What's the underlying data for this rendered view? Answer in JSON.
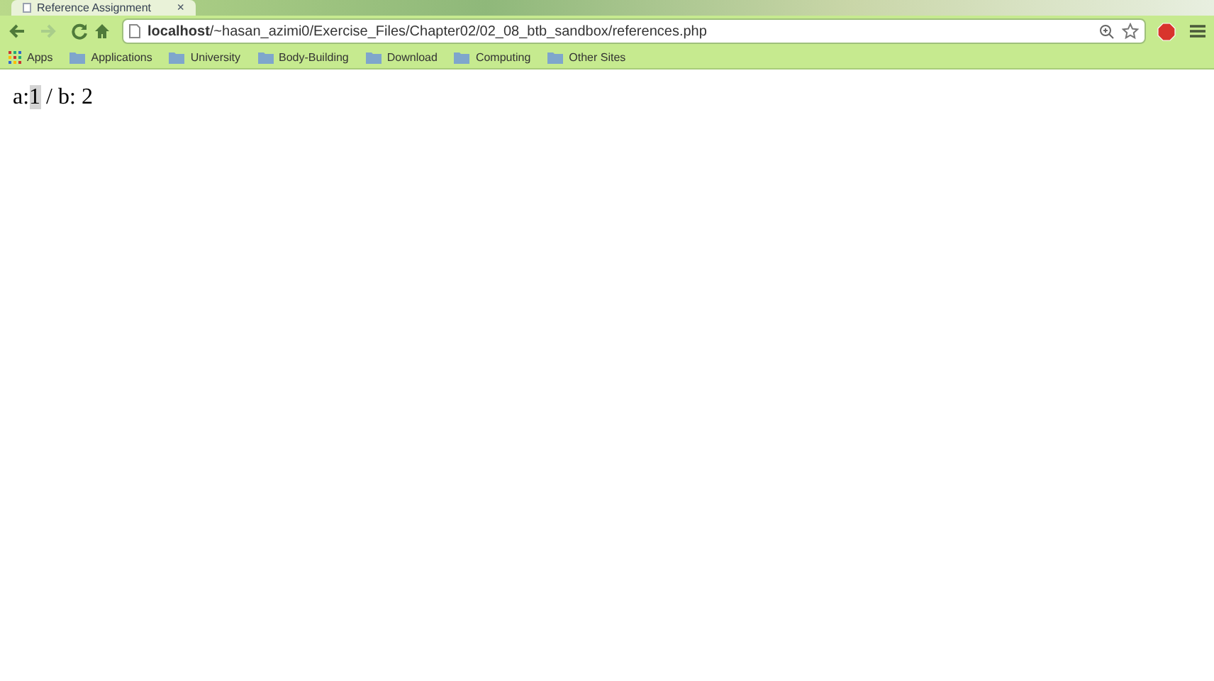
{
  "tab": {
    "title": "Reference Assignment",
    "close": "×"
  },
  "address_bar": {
    "host": "localhost",
    "path": "/~hasan_azimi0/Exercise_Files/Chapter02/02_08_btb_sandbox/references.php"
  },
  "bookmarks": [
    {
      "label": "Apps",
      "kind": "apps"
    },
    {
      "label": "Applications",
      "kind": "folder"
    },
    {
      "label": "University",
      "kind": "folder"
    },
    {
      "label": "Body-Building",
      "kind": "folder"
    },
    {
      "label": "Download",
      "kind": "folder"
    },
    {
      "label": "Computing",
      "kind": "folder"
    },
    {
      "label": "Other Sites",
      "kind": "folder"
    }
  ],
  "page": {
    "segments": [
      {
        "text": "a:",
        "selected": false
      },
      {
        "text": "1",
        "selected": true
      },
      {
        "text": " / b: 2",
        "selected": false
      }
    ]
  }
}
